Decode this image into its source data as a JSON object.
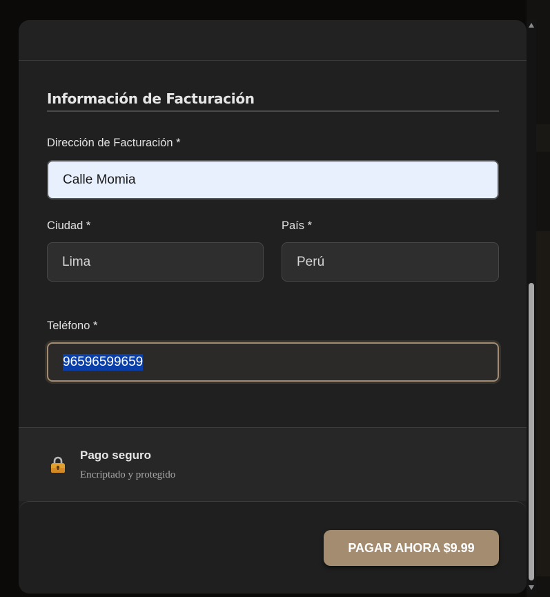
{
  "billing": {
    "section_title": "Información de Facturación",
    "address_label": "Dirección de Facturación *",
    "address_value": "Calle Momia",
    "city_label": "Ciudad *",
    "city_value": "Lima",
    "country_label": "País *",
    "country_value": "Perú",
    "phone_label": "Teléfono *",
    "phone_value": "96596599659"
  },
  "secure": {
    "title": "Pago seguro",
    "subtitle": "Encriptado y protegido",
    "icon": "lock-icon"
  },
  "footer": {
    "pay_label": "PAGAR AHORA $9.99"
  },
  "colors": {
    "accent": "#a38c6f",
    "autofill_bg": "#e8f0fe",
    "selection": "#0a3ea8",
    "panel": "#202020"
  }
}
